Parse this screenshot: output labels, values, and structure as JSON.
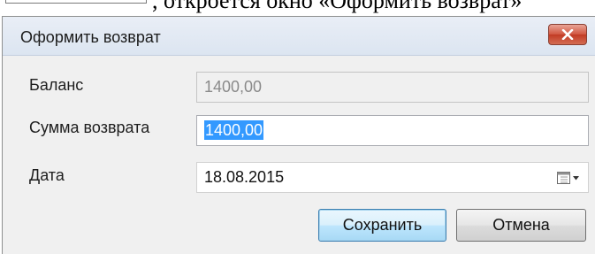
{
  "document": {
    "text": ", откроется окно «Оформить возврат»"
  },
  "dialog": {
    "title": "Оформить возврат",
    "close_icon": "close-icon"
  },
  "form": {
    "balance": {
      "label": "Баланс",
      "value": "1400,00"
    },
    "refund_amount": {
      "label": "Сумма возврата",
      "value": "1400,00"
    },
    "date": {
      "label": "Дата",
      "value": "18.08.2015",
      "picker_icon": "calendar-dropdown-icon"
    }
  },
  "buttons": {
    "save_label": "Сохранить",
    "cancel_label": "Отмена"
  },
  "colors": {
    "dialog_background": "#f0f0f0",
    "selection": "#3399ff",
    "close_button": "#c94a34",
    "default_button_border": "#3c7fb1"
  }
}
